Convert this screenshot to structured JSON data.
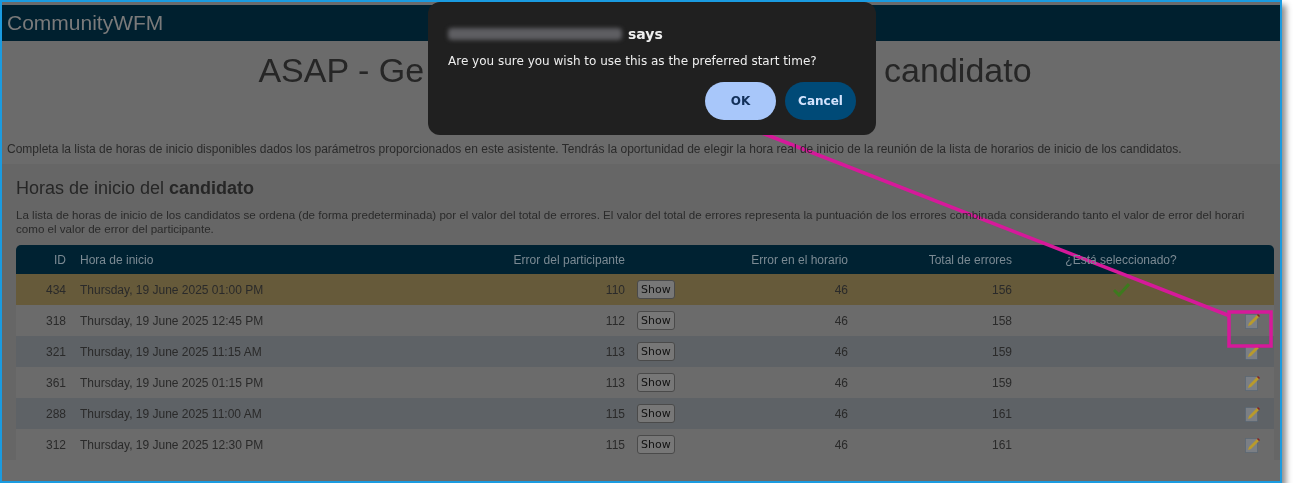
{
  "app": {
    "title": "CommunityWFM"
  },
  "page": {
    "title_parts": [
      "ASAP - Ge",
      "candidato"
    ],
    "intro": "Completa la lista de horas de inicio disponibles dados los parámetros proporcionados en este asistente. Tendrás la oportunidad de elegir la hora real de inicio de la reunión de la lista de horarios de inicio de los candidatos."
  },
  "section": {
    "heading": "Horas de inicio del **candidato**",
    "description_lines": [
      "La lista de horas de inicio de los candidatos se ordena (de forma predeterminada) por el valor del total de errores. El valor del total de errores representa la puntuación de los errores combinada considerando tanto el valor de error del horari",
      "como el valor de error del participante."
    ]
  },
  "table": {
    "columns": [
      "ID",
      "Hora de inicio",
      "Error del participante",
      "Error en el horario",
      "Total de errores",
      "¿Está seleccionado?"
    ],
    "rows": [
      {
        "id": "434",
        "start": "Thursday, 19 June 2025 01:00 PM",
        "participant_error": "110",
        "show": "Show",
        "schedule_error": "46",
        "total_errors": "156",
        "selected": true
      },
      {
        "id": "318",
        "start": "Thursday, 19 June 2025 12:45 PM",
        "participant_error": "112",
        "show": "Show",
        "schedule_error": "46",
        "total_errors": "158",
        "selected": false
      },
      {
        "id": "321",
        "start": "Thursday, 19 June 2025 11:15 AM",
        "participant_error": "113",
        "show": "Show",
        "schedule_error": "46",
        "total_errors": "159",
        "selected": false
      },
      {
        "id": "361",
        "start": "Thursday, 19 June 2025 01:15 PM",
        "participant_error": "113",
        "show": "Show",
        "schedule_error": "46",
        "total_errors": "159",
        "selected": false
      },
      {
        "id": "288",
        "start": "Thursday, 19 June 2025 11:00 AM",
        "participant_error": "115",
        "show": "Show",
        "schedule_error": "46",
        "total_errors": "161",
        "selected": false
      },
      {
        "id": "312",
        "start": "Thursday, 19 June 2025 12:30 PM",
        "participant_error": "115",
        "show": "Show",
        "schedule_error": "46",
        "total_errors": "161",
        "selected": false
      }
    ]
  },
  "dialog": {
    "title_suffix": "says",
    "message": "Are you sure you wish to use this as the preferred start time?",
    "buttons": [
      {
        "label": "OK",
        "kind": "primary"
      },
      {
        "label": "Cancel",
        "kind": "secondary"
      }
    ]
  }
}
